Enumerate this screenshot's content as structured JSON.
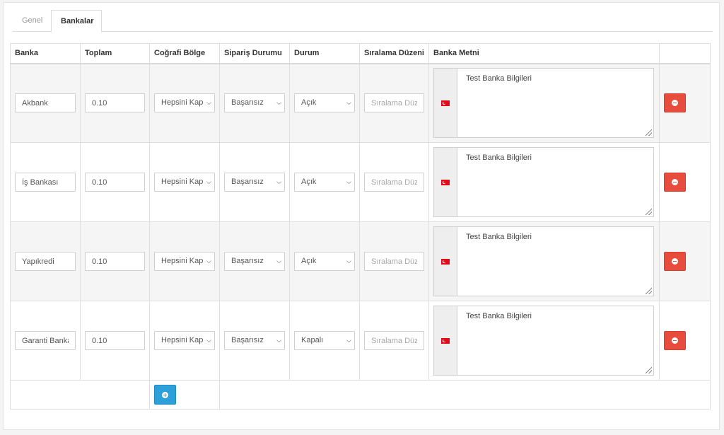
{
  "tabs": [
    {
      "label": "Genel"
    },
    {
      "label": "Bankalar"
    }
  ],
  "table": {
    "headers": [
      "Banka",
      "Toplam",
      "Coğrafi Bölge",
      "Sipariş Durumu",
      "Durum",
      "Sıralama Düzeni",
      "Banka Metni",
      ""
    ],
    "rows": [
      {
        "bank": "Akbank",
        "total": "0.10",
        "geo_zone": "Hepsini Kapsar",
        "order_status": "Başarısız",
        "status": "Açık",
        "sort_order": "",
        "text": "Test Banka Bilgileri"
      },
      {
        "bank": "İş Bankası",
        "total": "0.10",
        "geo_zone": "Hepsini Kapsar",
        "order_status": "Başarısız",
        "status": "Açık",
        "sort_order": "",
        "text": "Test Banka Bilgileri"
      },
      {
        "bank": "Yapıkredi",
        "total": "0.10",
        "geo_zone": "Hepsini Kapsar",
        "order_status": "Başarısız",
        "status": "Açık",
        "sort_order": "",
        "text": "Test Banka Bilgileri"
      },
      {
        "bank": "Garanti Bankası",
        "total": "0.10",
        "geo_zone": "Hepsini Kapsar",
        "order_status": "Başarısız",
        "status": "Kapalı",
        "sort_order": "",
        "text": "Test Banka Bilgileri"
      }
    ],
    "sort_placeholder": "Sıralama Düzeni",
    "language_flag": "turkey-flag-icon",
    "remove_icon": "minus-circle-icon",
    "add_icon": "plus-circle-icon"
  },
  "colors": {
    "remove_button": "#e74c3c",
    "add_button": "#2d9fd9",
    "row_stripe": "#f5f5f5"
  }
}
